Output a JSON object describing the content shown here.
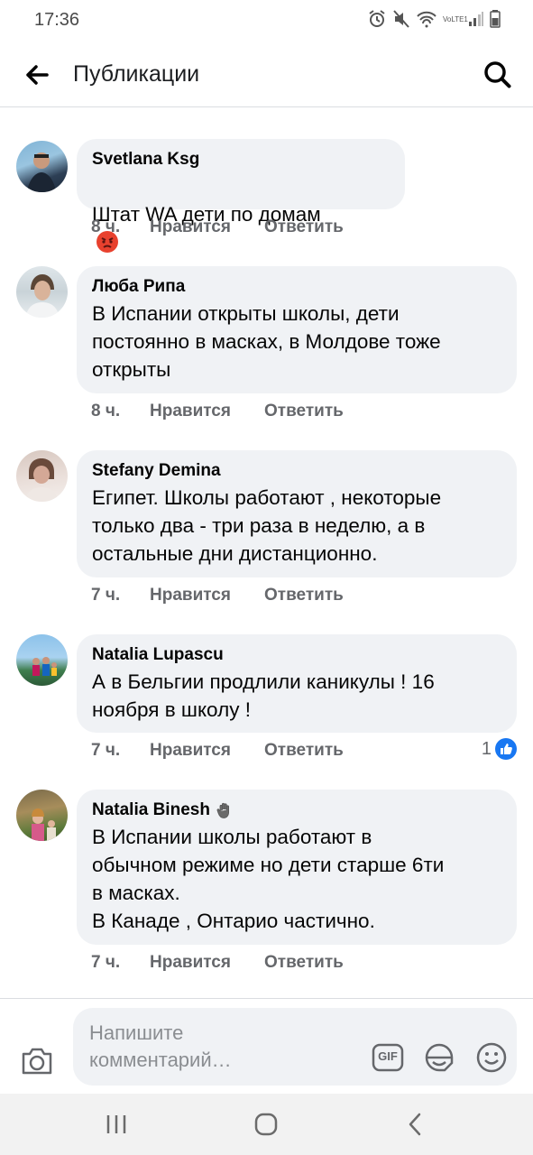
{
  "status": {
    "time": "17:36",
    "lte_label": "VoLTE1"
  },
  "header": {
    "title": "Публикации"
  },
  "comments": [
    {
      "author": "Svetlana Ksg",
      "text": "Штат WA дети по домам",
      "time": "8 ч.",
      "like": "Нравится",
      "reply": "Ответить",
      "emoji": "angry-face-emoji"
    },
    {
      "author": "Люба Рипа",
      "text": "В Испании открыты школы, дети\nпостоянно в масках, в Молдове тоже\nоткрыты",
      "time": "8 ч.",
      "like": "Нравится",
      "reply": "Ответить"
    },
    {
      "author": "Stefany Demina",
      "text": "Египет. Школы работают , некоторые\nтолько два - три раза в неделю, а в\nостальные дни дистанционно.",
      "time": "7 ч.",
      "like": "Нравится",
      "reply": "Ответить"
    },
    {
      "author": "Natalia Lupascu",
      "text": "А в Бельгии продлили каникулы ! 16\nноября в школу !",
      "time": "7 ч.",
      "like": "Нравится",
      "reply": "Ответить",
      "reaction_count": "1"
    },
    {
      "author": "Natalia Binesh",
      "text": "В Испании школы работают в\nобычном режиме но дети старше 6ти\nв масках.\nВ Канаде , Онтарио частично.",
      "time": "7 ч.",
      "like": "Нравится",
      "reply": "Ответить"
    }
  ],
  "composer": {
    "placeholder": "Напишите\nкомментарий…",
    "gif_label": "GIF"
  },
  "colors": {
    "accent": "#1877f2",
    "bubble": "#f0f2f5",
    "secondary_text": "#65676b"
  }
}
